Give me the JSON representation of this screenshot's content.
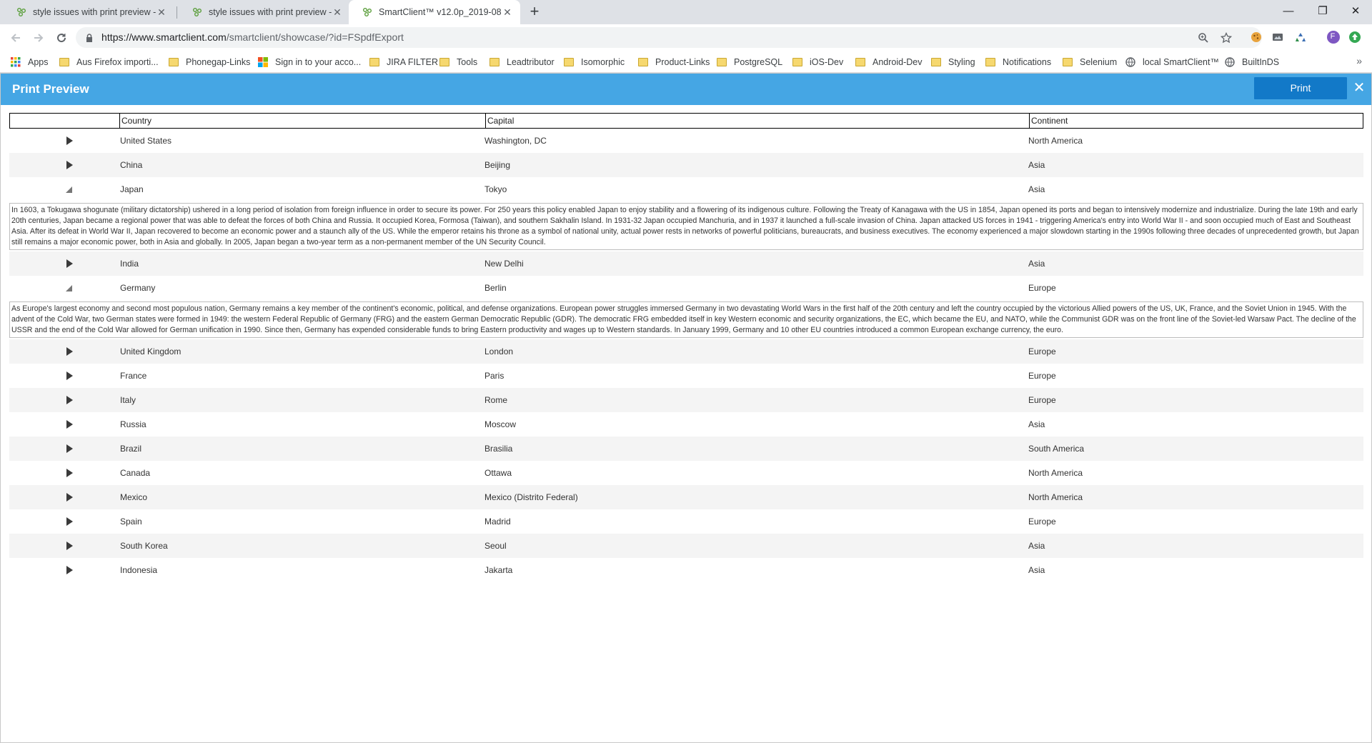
{
  "browser": {
    "tabs": [
      {
        "title": "style issues with print preview - S",
        "active": false
      },
      {
        "title": "style issues with print preview - S",
        "active": false
      },
      {
        "title": "SmartClient™ v12.0p_2019-08-08",
        "active": true
      }
    ],
    "new_tab": "+",
    "window_controls": {
      "minimize": "—",
      "restore": "❐",
      "close": "✕"
    },
    "url_host": "https://www.smartclient.com",
    "url_path": "/smartclient/showcase/?id=FSpdfExport",
    "bookmarks": [
      {
        "label": "Apps",
        "icon": "apps-grid-icon"
      },
      {
        "label": "Aus Firefox importi...",
        "icon": "folder-icon"
      },
      {
        "label": "Phonegap-Links",
        "icon": "folder-icon"
      },
      {
        "label": "Sign in to your acco...",
        "icon": "microsoft-icon"
      },
      {
        "label": "JIRA FILTER",
        "icon": "folder-icon"
      },
      {
        "label": "Tools",
        "icon": "folder-icon"
      },
      {
        "label": "Leadtributor",
        "icon": "folder-icon"
      },
      {
        "label": "Isomorphic",
        "icon": "folder-icon"
      },
      {
        "label": "Product-Links",
        "icon": "folder-icon"
      },
      {
        "label": "PostgreSQL",
        "icon": "folder-icon"
      },
      {
        "label": "iOS-Dev",
        "icon": "folder-icon"
      },
      {
        "label": "Android-Dev",
        "icon": "folder-icon"
      },
      {
        "label": "Styling",
        "icon": "folder-icon"
      },
      {
        "label": "Notifications",
        "icon": "folder-icon"
      },
      {
        "label": "Selenium",
        "icon": "folder-icon"
      },
      {
        "label": "local SmartClient™",
        "icon": "globe-icon"
      },
      {
        "label": "BuiltInDS",
        "icon": "globe-icon"
      }
    ],
    "bookmarks_more": "»",
    "profile_initial": "F"
  },
  "print_preview": {
    "title": "Print Preview",
    "print_label": "Print",
    "close_label": "✕",
    "columns": [
      "",
      "Country",
      "Capital",
      "Continent"
    ],
    "rows": [
      {
        "country": "United States",
        "capital": "Washington, DC",
        "continent": "North America",
        "expanded": false
      },
      {
        "country": "China",
        "capital": "Beijing",
        "continent": "Asia",
        "expanded": false
      },
      {
        "country": "Japan",
        "capital": "Tokyo",
        "continent": "Asia",
        "expanded": true,
        "detail": "In 1603, a Tokugawa shogunate (military dictatorship) ushered in a long period of isolation from foreign influence in order to secure its power. For 250 years this policy enabled Japan to enjoy stability and a flowering of its indigenous culture. Following the Treaty of Kanagawa with the US in 1854, Japan opened its ports and began to intensively modernize and industrialize. During the late 19th and early 20th centuries, Japan became a regional power that was able to defeat the forces of both China and Russia. It occupied Korea, Formosa (Taiwan), and southern Sakhalin Island. In 1931-32 Japan occupied Manchuria, and in 1937 it launched a full-scale invasion of China. Japan attacked US forces in 1941 - triggering America's entry into World War II - and soon occupied much of East and Southeast Asia. After its defeat in World War II, Japan recovered to become an economic power and a staunch ally of the US. While the emperor retains his throne as a symbol of national unity, actual power rests in networks of powerful politicians, bureaucrats, and business executives. The economy experienced a major slowdown starting in the 1990s following three decades of unprecedented growth, but Japan still remains a major economic power, both in Asia and globally. In 2005, Japan began a two-year term as a non-permanent member of the UN Security Council."
      },
      {
        "country": "India",
        "capital": "New Delhi",
        "continent": "Asia",
        "expanded": false
      },
      {
        "country": "Germany",
        "capital": "Berlin",
        "continent": "Europe",
        "expanded": true,
        "detail": "As Europe's largest economy and second most populous nation, Germany remains a key member of the continent's economic, political, and defense organizations. European power struggles immersed Germany in two devastating World Wars in the first half of the 20th century and left the country occupied by the victorious Allied powers of the US, UK, France, and the Soviet Union in 1945. With the advent of the Cold War, two German states were formed in 1949: the western Federal Republic of Germany (FRG) and the eastern German Democratic Republic (GDR). The democratic FRG embedded itself in key Western economic and security organizations, the EC, which became the EU, and NATO, while the Communist GDR was on the front line of the Soviet-led Warsaw Pact. The decline of the USSR and the end of the Cold War allowed for German unification in 1990. Since then, Germany has expended considerable funds to bring Eastern productivity and wages up to Western standards. In January 1999, Germany and 10 other EU countries introduced a common European exchange currency, the euro."
      },
      {
        "country": "United Kingdom",
        "capital": "London",
        "continent": "Europe",
        "expanded": false
      },
      {
        "country": "France",
        "capital": "Paris",
        "continent": "Europe",
        "expanded": false
      },
      {
        "country": "Italy",
        "capital": "Rome",
        "continent": "Europe",
        "expanded": false
      },
      {
        "country": "Russia",
        "capital": "Moscow",
        "continent": "Asia",
        "expanded": false
      },
      {
        "country": "Brazil",
        "capital": "Brasilia",
        "continent": "South America",
        "expanded": false
      },
      {
        "country": "Canada",
        "capital": "Ottawa",
        "continent": "North America",
        "expanded": false
      },
      {
        "country": "Mexico",
        "capital": "Mexico (Distrito Federal)",
        "continent": "North America",
        "expanded": false
      },
      {
        "country": "Spain",
        "capital": "Madrid",
        "continent": "Europe",
        "expanded": false
      },
      {
        "country": "South Korea",
        "capital": "Seoul",
        "continent": "Asia",
        "expanded": false
      },
      {
        "country": "Indonesia",
        "capital": "Jakarta",
        "continent": "Asia",
        "expanded": false
      }
    ]
  },
  "colors": {
    "header_blue": "#45a6e4",
    "print_button": "#1279c8",
    "alt_row": "#f4f4f4"
  }
}
